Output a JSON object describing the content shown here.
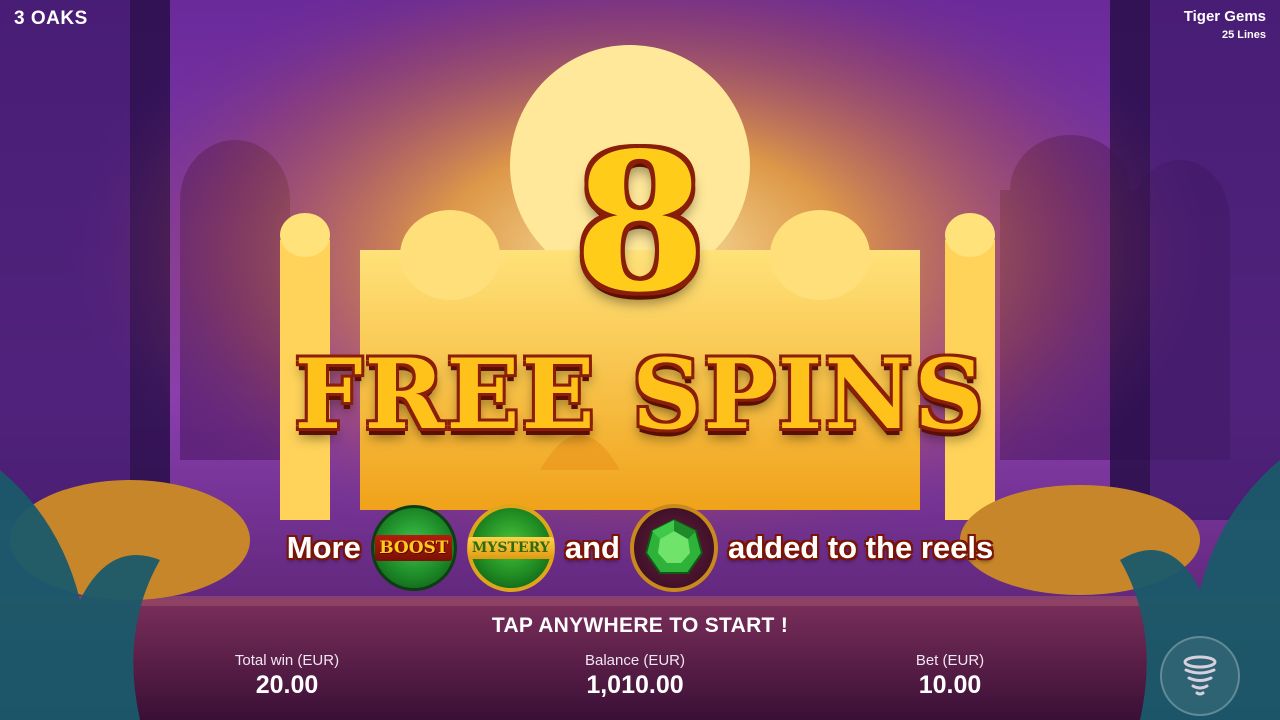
{
  "header": {
    "provider": "3 OAKS",
    "game_title": "Tiger Gems",
    "lines": "25 Lines"
  },
  "popup": {
    "spins_count": "8",
    "title": "FREE SPINS",
    "feature_more": "More",
    "feature_and": "and",
    "feature_tail": "added to the reels",
    "boost_label": "BOOST",
    "mystery_label": "MYSTERY",
    "tap_prompt": "TAP ANYWHERE TO START !"
  },
  "stats": {
    "total_win_label": "Total win (EUR)",
    "total_win_value": "20.00",
    "balance_label": "Balance (EUR)",
    "balance_value": "1,010.00",
    "bet_label": "Bet (EUR)",
    "bet_value": "10.00"
  },
  "icons": {
    "menu": "tornado-menu-icon",
    "boost": "boost-symbol-icon",
    "mystery": "mystery-symbol-icon",
    "gem": "emerald-gem-icon"
  },
  "colors": {
    "title_gold": "#ffc21a",
    "outline_red": "#8a1e08",
    "gem_green": "#2fb23a"
  }
}
